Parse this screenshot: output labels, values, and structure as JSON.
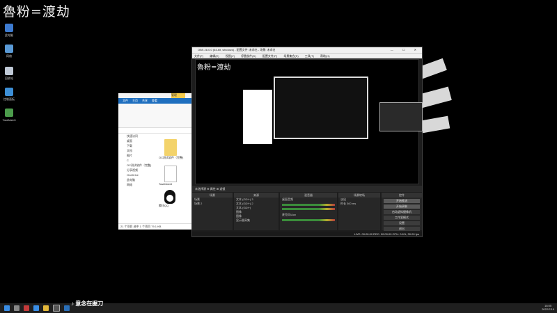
{
  "desktop": {
    "watermark": "魯粉=渡劫",
    "icons": [
      {
        "label": "此电脑",
        "icon": "computer-icon"
      },
      {
        "label": "网络",
        "icon": "network-icon"
      },
      {
        "label": "回收站",
        "icon": "recycle-bin-icon"
      },
      {
        "label": "控制面板",
        "icon": "control-panel-icon"
      },
      {
        "label": "TaskMain5",
        "icon": "app-icon"
      }
    ]
  },
  "explorer": {
    "ribbon_tabs": [
      "文件",
      "主页",
      "共享",
      "查看"
    ],
    "manage_tab": "管理",
    "nav_items": [
      "快速访问",
      "桌面",
      "下载",
      "文档",
      "图片",
      "C",
      "OC测试软件（完整)",
      "分享视频",
      "OneDrive",
      "此电脑",
      "网络"
    ],
    "files": [
      {
        "name": "OC测试软件（完整)",
        "type": "folder"
      },
      {
        "name": "TaskMain5",
        "type": "file"
      },
      {
        "name": "腾讯QQ",
        "type": "qq"
      }
    ],
    "status": "21 个项目    选中 1 个项目  79.1 KB"
  },
  "obs": {
    "title": "OBS 28.0.0 (64-bit, windows) - 配置文件: 未命名 - 场景: 未命名",
    "window_controls": "— ☐ ✕",
    "menu": [
      "文件(F)",
      "编辑(E)",
      "视图(V)",
      "停靠部件(D)",
      "配置文件(P)",
      "场景集合(S)",
      "工具(T)",
      "帮助(H)"
    ],
    "preview_watermark": "魯粉=渡劫",
    "control_bar": "未选择源    ⚙ 属性   ⊞ 滤镜",
    "docks": {
      "scenes": {
        "header": "场景",
        "items": [
          "场景",
          "场景 2"
        ]
      },
      "sources": {
        "header": "来源",
        "items": [
          "文本 (GDI+) 3",
          "文本 (GDI+) 2",
          "文本 (GDI+)",
          "图像",
          "图像",
          "显示器采集"
        ]
      },
      "mixer": {
        "header": "混音器",
        "items": [
          "桌面音频",
          "麦克风/Aux"
        ]
      },
      "transitions": {
        "header": "场景转场",
        "items": [
          "淡出",
          "时长  300 ms"
        ]
      },
      "controls": {
        "header": "控件",
        "buttons": [
          "开始推流",
          "开始录制",
          "启动虚拟摄像机",
          "工作室模式",
          "设置",
          "退出"
        ]
      }
    },
    "status": "LIVE: 00:00:00   REC: 00:00:00   CPU: 0.6%, 30.00 fps"
  },
  "taskbar": {
    "tiktok_label": "意念在握刀",
    "clock_time": "16:05",
    "clock_date": "2022/7/19"
  }
}
